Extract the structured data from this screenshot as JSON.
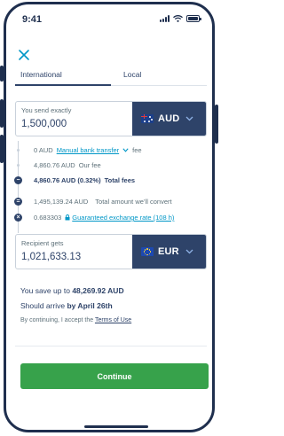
{
  "status_bar": {
    "time": "9:41"
  },
  "tabs": [
    {
      "label": "International",
      "active": true
    },
    {
      "label": "Local",
      "active": false
    }
  ],
  "send": {
    "label": "You send exactly",
    "amount": "1,500,000",
    "currency": "AUD",
    "flag_icon": "australia-flag-icon"
  },
  "fees": {
    "bank_transfer_amount": "0 AUD",
    "bank_transfer_link": "Manual bank transfer",
    "bank_transfer_suffix": "fee",
    "our_fee_amount": "4,860.76 AUD",
    "our_fee_label": "Our fee",
    "total_fees_amount": "4,860.76 AUD (0.32%)",
    "total_fees_label": "Total fees",
    "minus_symbol": "−",
    "convert_amount": "1,495,139.24 AUD",
    "convert_label": "Total amount we’ll convert",
    "equals_symbol": "=",
    "rate_value": "0.683303",
    "rate_link": "Guaranteed exchange rate (108 h)",
    "times_symbol": "×"
  },
  "receive": {
    "label": "Recipient gets",
    "amount": "1,021,633.13",
    "currency": "EUR",
    "flag_icon": "eu-flag-icon"
  },
  "summary": {
    "savings_prefix": "You save up to",
    "savings_amount": "48,269.92 AUD",
    "arrive_prefix": "Should arrive",
    "arrive_date": "by April 26th",
    "terms_prefix": "By continuing, I accept the",
    "terms_link": "Terms of Use"
  },
  "actions": {
    "continue_label": "Continue"
  },
  "colors": {
    "primary_navy": "#2e4369",
    "accent_blue": "#0097c7",
    "continue_green": "#37a24b"
  }
}
